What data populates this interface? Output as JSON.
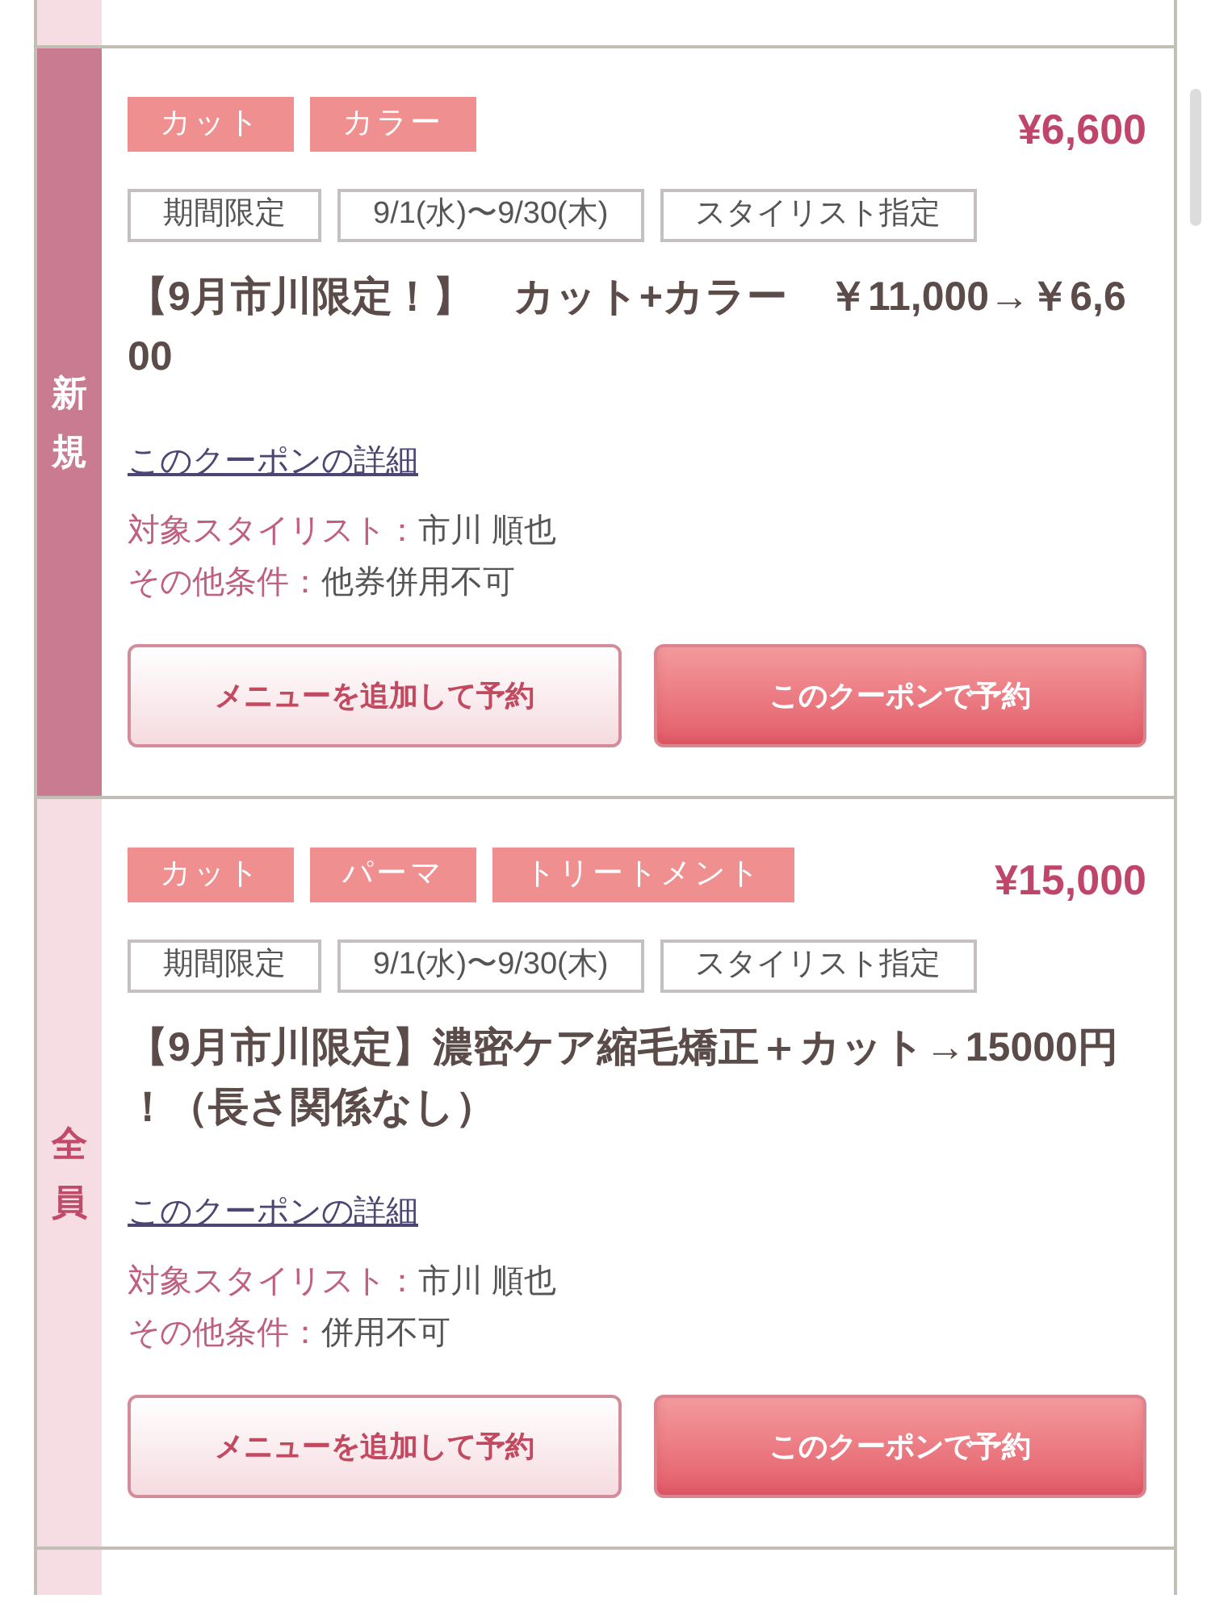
{
  "cards": [
    {
      "kind": "cut_off",
      "band": {
        "kind": "tinted"
      }
    },
    {
      "kind": "coupon",
      "band": {
        "kind": "filled",
        "label": "新規"
      },
      "tags": [
        "カット",
        "カラー"
      ],
      "price": "¥6,600",
      "info": [
        "期間限定",
        "9/1(水)〜9/30(木)",
        "スタイリスト指定"
      ],
      "title": "【9月市川限定！】　カット+カラー　￥11,000→￥6,600",
      "detail_link": "このクーポンの詳細",
      "conditions": [
        {
          "label": "対象スタイリスト：",
          "value": "市川 順也"
        },
        {
          "label": "その他条件：",
          "value": "他券併用不可"
        }
      ],
      "buttons": [
        {
          "kind": "secondary",
          "label": "メニューを追加して予約"
        },
        {
          "kind": "primary",
          "label": "このクーポンで予約"
        }
      ]
    },
    {
      "kind": "coupon",
      "band": {
        "kind": "tinted",
        "label": "全員"
      },
      "tags": [
        "カット",
        "パーマ",
        "トリートメント"
      ],
      "price": "¥15,000",
      "info": [
        "期間限定",
        "9/1(水)〜9/30(木)",
        "スタイリスト指定"
      ],
      "title": "【9月市川限定】濃密ケア縮毛矯正＋カット→15000円！（長さ関係なし）",
      "detail_link": "このクーポンの詳細",
      "conditions": [
        {
          "label": "対象スタイリスト：",
          "value": "市川 順也"
        },
        {
          "label": "その他条件：",
          "value": "併用不可"
        }
      ],
      "buttons": [
        {
          "kind": "secondary",
          "label": "メニューを追加して予約"
        },
        {
          "kind": "primary",
          "label": "このクーポンで予約"
        }
      ]
    },
    {
      "kind": "cut_off",
      "band": {
        "kind": "tinted"
      }
    }
  ]
}
